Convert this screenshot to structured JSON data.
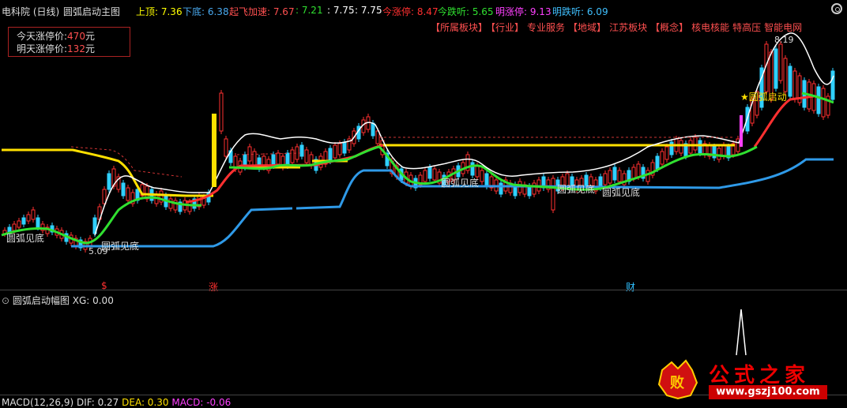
{
  "header": {
    "stock": "电科院 (日线)",
    "indicator": "圆弧启动主图",
    "items": [
      {
        "label": "上顶: 7.36",
        "color": "#ffff00"
      },
      {
        "label": "下底: 6.38",
        "color": "#4aaaf0"
      },
      {
        "label": "起飞加速: 7.67",
        "color": "#ff5050"
      },
      {
        "label": ": 7.21",
        "color": "#30e030"
      },
      {
        "label": ": 7.75",
        "color": "#ffffff"
      },
      {
        "label": ": 7.75",
        "color": "#ffffff"
      },
      {
        "label": "今涨停: 8.47",
        "color": "#ff3030"
      },
      {
        "label": "今跌听: 5.65",
        "color": "#30e030"
      },
      {
        "label": "明涨停: 9.13",
        "color": "#ff40ff"
      },
      {
        "label": "明跌听: 6.09",
        "color": "#40c0ff"
      }
    ]
  },
  "info_box": {
    "today_label": "今天涨停价:",
    "today_value": "470",
    "today_unit": "元",
    "tomorrow_label": "明天涨停价:",
    "tomorrow_value": "132",
    "tomorrow_unit": "元"
  },
  "tags": [
    "【所属板块】",
    "【行业】",
    "专业服务",
    "【地域】",
    "江苏板块",
    "【概念】",
    "核电核能",
    "特高压",
    "智能电网"
  ],
  "chart_labels": {
    "bottom1": "圆弧见底",
    "bottom2": "圆弧见底",
    "bottom3": "圆弧见底",
    "bottom4": "圆弧见底",
    "bottom5": "圆弧见底",
    "start": "★圆弧启动",
    "high": "8.19",
    "low": "5.09"
  },
  "markers": {
    "m1": "$",
    "m2": "涨",
    "m3": "财"
  },
  "sub": {
    "title": "圆弧启动幅图",
    "xg": "XG: 0.00"
  },
  "macd": {
    "name": "MACD(12,26,9)",
    "dif": "DIF: 0.27",
    "dea": "DEA: 0.30",
    "macd": "MACD: -0.06"
  },
  "logo": {
    "text": "公式之家",
    "url": "www.gszj100.com"
  },
  "watermark": "公式之家",
  "colors": {
    "up": "#ff3030",
    "down": "#30d0ff",
    "yellow": "#ffe000",
    "blue": "#2f9ae8",
    "green": "#30e030",
    "white": "#ffffff"
  }
}
